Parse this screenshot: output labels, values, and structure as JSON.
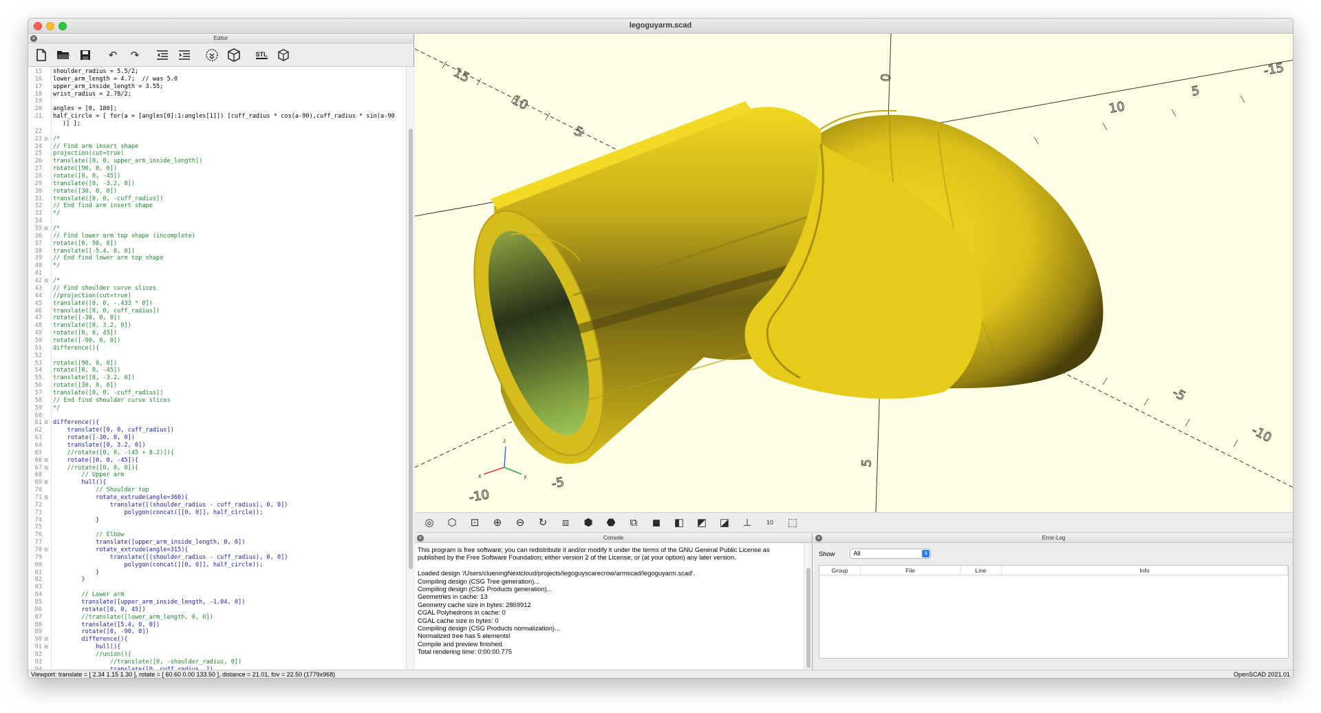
{
  "window": {
    "title": "legoguyarm.scad"
  },
  "editor": {
    "header": "Editor",
    "toolbar": [
      "new-icon",
      "open-icon",
      "save-icon",
      "undo-icon",
      "redo-icon",
      "unindent-icon",
      "indent-icon",
      "preview-icon",
      "render-icon",
      "export-stl-icon",
      "send-to-printer-icon"
    ],
    "stl_label": "STL",
    "lines": [
      {
        "n": "15",
        "fold": "",
        "text": "shoulder_radius = 5.5/2;",
        "cls": ""
      },
      {
        "n": "16",
        "fold": "",
        "text": "lower_arm_length = 4.7;  // was 5.0",
        "cls": ""
      },
      {
        "n": "17",
        "fold": "",
        "text": "upper_arm_inside_length = 3.55;",
        "cls": ""
      },
      {
        "n": "18",
        "fold": "",
        "text": "wrist_radius = 2.78/2;",
        "cls": ""
      },
      {
        "n": "19",
        "fold": "",
        "text": "",
        "cls": ""
      },
      {
        "n": "20",
        "fold": "",
        "text": "angles = [0, 180];",
        "cls": ""
      },
      {
        "n": "21",
        "fold": "",
        "text": "half_circle = [ for(a = [angles[0]:1:angles[1]]) [cuff_radius * cos(a-90),cuff_radius * sin(a-90",
        "cls": ""
      },
      {
        "n": "",
        "fold": "",
        "text": ")] ];",
        "cls": "cont"
      },
      {
        "n": "22",
        "fold": "",
        "text": "",
        "cls": ""
      },
      {
        "n": "23",
        "fold": "⊟",
        "text": "/*",
        "cls": "comment"
      },
      {
        "n": "24",
        "fold": "",
        "text": "// Find arm insert shape",
        "cls": "comment"
      },
      {
        "n": "25",
        "fold": "",
        "text": "projection(cut=true)",
        "cls": "comment"
      },
      {
        "n": "26",
        "fold": "",
        "text": "translate([0, 0, upper_arm_inside_length])",
        "cls": "comment"
      },
      {
        "n": "27",
        "fold": "",
        "text": "rotate([90, 0, 0])",
        "cls": "comment"
      },
      {
        "n": "28",
        "fold": "",
        "text": "rotate([0, 0, -45])",
        "cls": "comment"
      },
      {
        "n": "29",
        "fold": "",
        "text": "translate([0, -3.2, 0])",
        "cls": "comment"
      },
      {
        "n": "30",
        "fold": "",
        "text": "rotate([30, 0, 0])",
        "cls": "comment"
      },
      {
        "n": "31",
        "fold": "",
        "text": "translate([0, 0, -cuff_radius])",
        "cls": "comment"
      },
      {
        "n": "32",
        "fold": "",
        "text": "// End find arm insert shape",
        "cls": "comment"
      },
      {
        "n": "33",
        "fold": "",
        "text": "*/",
        "cls": "comment"
      },
      {
        "n": "34",
        "fold": "",
        "text": "",
        "cls": ""
      },
      {
        "n": "35",
        "fold": "⊟",
        "text": "/*",
        "cls": "comment"
      },
      {
        "n": "36",
        "fold": "",
        "text": "// Find lower arm top shape (incomplete)",
        "cls": "comment"
      },
      {
        "n": "37",
        "fold": "",
        "text": "rotate([0, 90, 0])",
        "cls": "comment"
      },
      {
        "n": "38",
        "fold": "",
        "text": "translate([-5.4, 0, 0])",
        "cls": "comment"
      },
      {
        "n": "39",
        "fold": "",
        "text": "// End find lower arm top shape",
        "cls": "comment"
      },
      {
        "n": "40",
        "fold": "",
        "text": "*/",
        "cls": "comment"
      },
      {
        "n": "41",
        "fold": "",
        "text": "",
        "cls": ""
      },
      {
        "n": "42",
        "fold": "⊟",
        "text": "/*",
        "cls": "comment"
      },
      {
        "n": "43",
        "fold": "",
        "text": "// Find shoulder curve slices",
        "cls": "comment"
      },
      {
        "n": "44",
        "fold": "",
        "text": "//projection(cut=true)",
        "cls": "comment"
      },
      {
        "n": "45",
        "fold": "",
        "text": "translate([0, 0, -.433 * 0])",
        "cls": "comment"
      },
      {
        "n": "46",
        "fold": "",
        "text": "translate([0, 0, cuff_radius])",
        "cls": "comment"
      },
      {
        "n": "47",
        "fold": "",
        "text": "rotate([-30, 0, 0])",
        "cls": "comment"
      },
      {
        "n": "48",
        "fold": "",
        "text": "translate([0, 3.2, 0])",
        "cls": "comment"
      },
      {
        "n": "49",
        "fold": "",
        "text": "rotate([0, 0, 45])",
        "cls": "comment"
      },
      {
        "n": "50",
        "fold": "",
        "text": "rotate([-90, 0, 0])",
        "cls": "comment"
      },
      {
        "n": "51",
        "fold": "",
        "text": "difference(){",
        "cls": "comment"
      },
      {
        "n": "52",
        "fold": "",
        "text": "",
        "cls": ""
      },
      {
        "n": "53",
        "fold": "",
        "text": "rotate([90, 0, 0])",
        "cls": "comment"
      },
      {
        "n": "54",
        "fold": "",
        "text": "rotate([0, 0, -45])",
        "cls": "comment"
      },
      {
        "n": "55",
        "fold": "",
        "text": "translate([0, -3.2, 0])",
        "cls": "comment"
      },
      {
        "n": "56",
        "fold": "",
        "text": "rotate([30, 0, 0])",
        "cls": "comment"
      },
      {
        "n": "57",
        "fold": "",
        "text": "translate([0, 0, -cuff_radius])",
        "cls": "comment"
      },
      {
        "n": "58",
        "fold": "",
        "text": "// End find shoulder curve slices",
        "cls": "comment"
      },
      {
        "n": "59",
        "fold": "",
        "text": "*/",
        "cls": "comment"
      },
      {
        "n": "60",
        "fold": "",
        "text": "",
        "cls": ""
      },
      {
        "n": "61",
        "fold": "⊟",
        "text": "difference(){",
        "cls": "kw"
      },
      {
        "n": "62",
        "fold": "",
        "text": "    translate([0, 0, cuff_radius])",
        "cls": "kw"
      },
      {
        "n": "63",
        "fold": "",
        "text": "    rotate([-30, 0, 0])",
        "cls": "kw"
      },
      {
        "n": "64",
        "fold": "",
        "text": "    translate([0, 3.2, 0])",
        "cls": "kw"
      },
      {
        "n": "65",
        "fold": "",
        "text": "    //rotate([0, 0, -(45 + 8.2)]){",
        "cls": "comment"
      },
      {
        "n": "66",
        "fold": "⊟",
        "text": "    rotate([0, 0, -45]){",
        "cls": "kw"
      },
      {
        "n": "67",
        "fold": "⊟",
        "text": "    //rotate([0, 0, 0]){",
        "cls": "comment"
      },
      {
        "n": "68",
        "fold": "",
        "text": "        // Upper arm",
        "cls": "comment"
      },
      {
        "n": "69",
        "fold": "⊟",
        "text": "        hull(){",
        "cls": "kw"
      },
      {
        "n": "70",
        "fold": "",
        "text": "            // Shoulder top",
        "cls": "comment"
      },
      {
        "n": "71",
        "fold": "⊟",
        "text": "            rotate_extrude(angle=360){",
        "cls": "kw"
      },
      {
        "n": "72",
        "fold": "",
        "text": "                translate([(shoulder_radius - cuff_radius), 0, 0])",
        "cls": "kw"
      },
      {
        "n": "73",
        "fold": "",
        "text": "                    polygon(concat([[0, 0]], half_circle));",
        "cls": "kw"
      },
      {
        "n": "74",
        "fold": "",
        "text": "            }",
        "cls": "kw"
      },
      {
        "n": "75",
        "fold": "",
        "text": "",
        "cls": ""
      },
      {
        "n": "76",
        "fold": "",
        "text": "            // Elbow",
        "cls": "comment"
      },
      {
        "n": "77",
        "fold": "",
        "text": "            translate([upper_arm_inside_length, 0, 0])",
        "cls": "kw"
      },
      {
        "n": "78",
        "fold": "⊟",
        "text": "            rotate_extrude(angle=315){",
        "cls": "kw"
      },
      {
        "n": "79",
        "fold": "",
        "text": "                translate([(shoulder_radius - cuff_radius), 0, 0])",
        "cls": "kw"
      },
      {
        "n": "80",
        "fold": "",
        "text": "                    polygon(concat([[0, 0]], half_circle));",
        "cls": "kw"
      },
      {
        "n": "81",
        "fold": "",
        "text": "            }",
        "cls": "kw"
      },
      {
        "n": "82",
        "fold": "",
        "text": "        }",
        "cls": "kw"
      },
      {
        "n": "83",
        "fold": "",
        "text": "",
        "cls": ""
      },
      {
        "n": "84",
        "fold": "",
        "text": "        // Lower arm",
        "cls": "comment"
      },
      {
        "n": "85",
        "fold": "",
        "text": "        translate([upper_arm_inside_length, -1.04, 0])",
        "cls": "kw"
      },
      {
        "n": "86",
        "fold": "",
        "text": "        rotate([0, 0, 45])",
        "cls": "kw"
      },
      {
        "n": "87",
        "fold": "",
        "text": "        //translate([lower_arm_length, 0, 0])",
        "cls": "comment"
      },
      {
        "n": "88",
        "fold": "",
        "text": "        translate([5.4, 0, 0])",
        "cls": "kw"
      },
      {
        "n": "89",
        "fold": "",
        "text": "        rotate([0, -90, 0])",
        "cls": "kw"
      },
      {
        "n": "90",
        "fold": "⊟",
        "text": "        difference(){",
        "cls": "kw"
      },
      {
        "n": "91",
        "fold": "⊟",
        "text": "            hull(){",
        "cls": "kw"
      },
      {
        "n": "92",
        "fold": "",
        "text": "            //union(){",
        "cls": "comment"
      },
      {
        "n": "93",
        "fold": "",
        "text": "                //translate([0, -shoulder_radius, 0])",
        "cls": "comment"
      },
      {
        "n": "94",
        "fold": "",
        "text": "                translate([0, cuff_radius, ])",
        "cls": "kw"
      }
    ]
  },
  "viewport": {
    "axis_tick_labels": [
      "15",
      "10",
      "5",
      "-5",
      "-10",
      "-15",
      "5",
      "10",
      "-5",
      "-10",
      "0",
      "5",
      "-5",
      "-10",
      "10"
    ],
    "gizmo_labels": {
      "z": "z",
      "x": "x",
      "y": "y"
    }
  },
  "viewport_toolbar": {
    "buttons": [
      "preview-icon",
      "render-icon",
      "view-all-icon",
      "zoom-in-icon",
      "zoom-out-icon",
      "reset-view-icon",
      "view-right-icon",
      "view-top-icon",
      "view-bottom-icon",
      "view-left-icon",
      "view-front-icon",
      "view-back-icon",
      "perspective-icon",
      "orthogonal-icon",
      "show-axes-icon",
      "show-scale-markers-icon",
      "show-edges-icon"
    ],
    "scale_marker_label": "10"
  },
  "console": {
    "header": "Console",
    "lines": [
      "This program is free software; you can redistribute it and/or modify it under the terms of the GNU General Public License as",
      "published by the Free Software Foundation; either version 2 of the License, or (at your option) any later version.",
      "",
      "Loaded design '/Users/clueningNextcloud/projects/legoguyscarecrow/armscad/legoguyarm.scad'.",
      "Compiling design (CSG Tree generation)...",
      "Compiling design (CSG Products generation)...",
      "Geometries in cache: 13",
      "Geometry cache size in bytes: 2869912",
      "CGAL Polyhedrons in cache: 0",
      "CGAL cache size in bytes: 0",
      "Compiling design (CSG Products normalization)...",
      "Normalized tree has 5 elements!",
      "Compile and preview finished.",
      "Total rendering time: 0:00:00.775"
    ]
  },
  "error_log": {
    "header": "Error-Log",
    "show_label": "Show",
    "show_value": "All",
    "columns": [
      "Group",
      "File",
      "Line",
      "Info"
    ]
  },
  "status": {
    "left": "Viewport: translate = [ 2.34 1.15 1.30 ], rotate = [ 60.60 0.00 133.50 ], distance = 21.01, fov = 22.50 (1779x968)",
    "right": "OpenSCAD 2021.01"
  },
  "colors": {
    "viewport_bg": "#ffffe5",
    "model_yellow": "#e8cf00",
    "comment_green": "#1b8a2e",
    "keyword_blue": "#1d21b8"
  }
}
